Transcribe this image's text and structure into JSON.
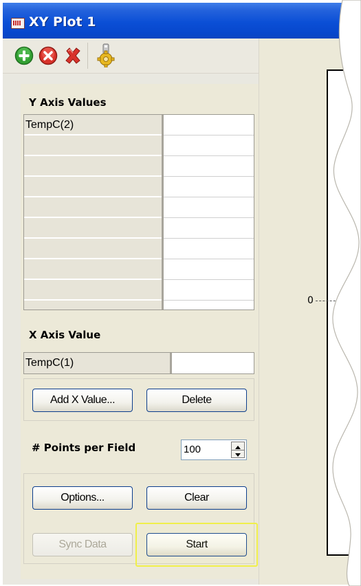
{
  "window": {
    "title": "XY Plot 1"
  },
  "toolbar": {
    "icons": [
      "add-icon",
      "remove-icon",
      "delete-icon",
      "settings-icon"
    ],
    "colors": {
      "add": "#2e9e2e",
      "remove": "#d8322a",
      "delete": "#d8322a",
      "settings": "#e8b820"
    }
  },
  "y_axis": {
    "label": "Y Axis Values",
    "rows": [
      "TempC(2)",
      "",
      "",
      "",
      "",
      "",
      "",
      "",
      "",
      ""
    ]
  },
  "x_axis": {
    "label": "X Axis Value",
    "value": "TempC(1)"
  },
  "buttons": {
    "add_x": "Add X Value...",
    "delete": "Delete",
    "options": "Options...",
    "clear": "Clear",
    "sync": "Sync Data",
    "start": "Start"
  },
  "points": {
    "label": "# Points per Field",
    "value": "100"
  },
  "plot": {
    "y_tick_label": "0"
  },
  "colors": {
    "titlebar": "#0b4fd6",
    "panel_bg": "#ece9d8",
    "highlight": "#f0ef4a"
  }
}
